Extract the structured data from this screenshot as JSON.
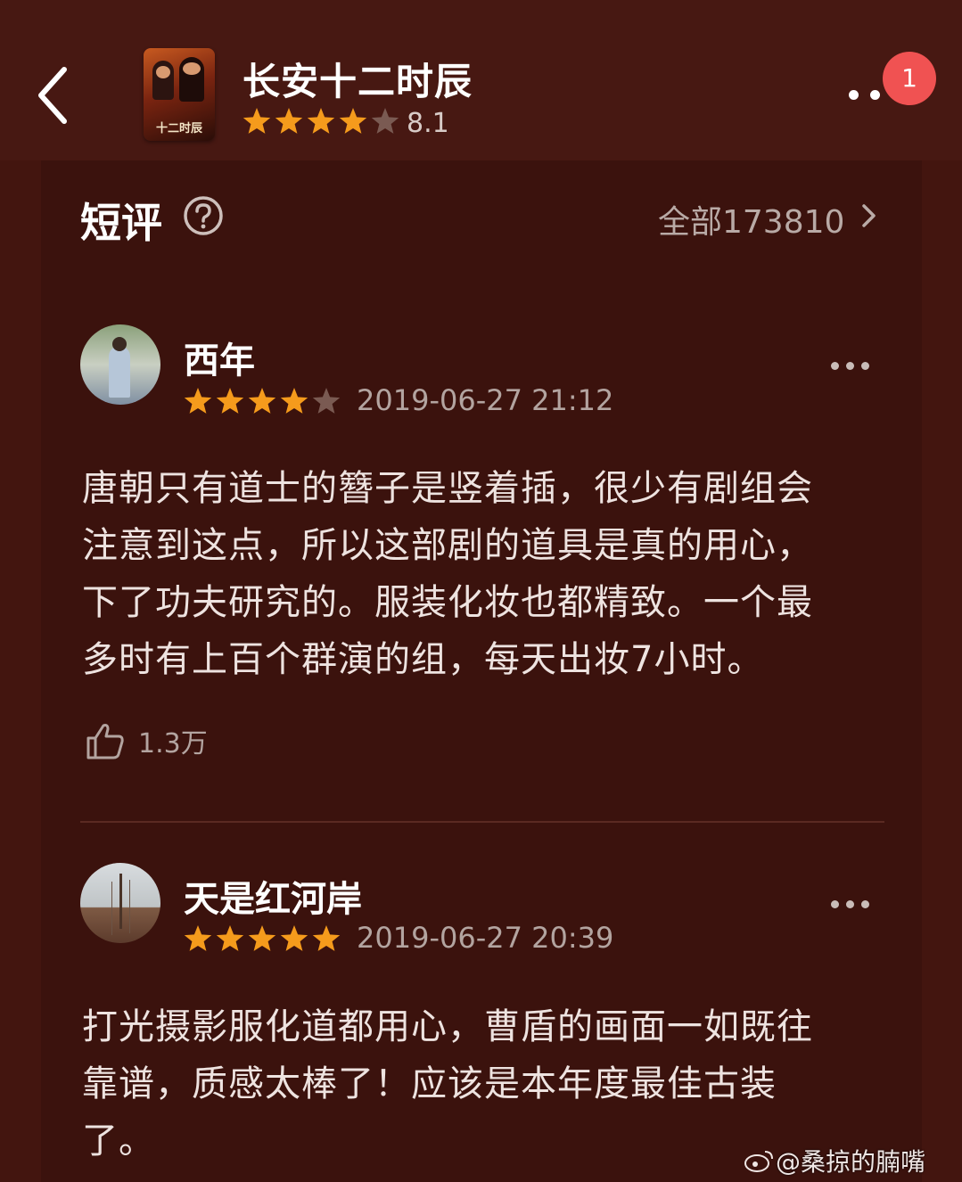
{
  "header": {
    "back_icon": "chevron-left-icon",
    "title": "长安十二时辰",
    "rating_stars": 4,
    "rating_score": "8.1",
    "poster_text": "十二时辰",
    "more_icon": "more-dots-icon",
    "badge_count": "1"
  },
  "section": {
    "title": "短评",
    "help_icon": "question-circle-icon",
    "all_label": "全部173810",
    "chevron_icon": "chevron-right-icon"
  },
  "reviews": [
    {
      "user": "西年",
      "stars": 4,
      "date": "2019-06-27 21:12",
      "text_lines": [
        "唐朝只有道士的簪子是竖着插，很少有剧组会",
        "注意到这点，所以这部剧的道具是真的用心，",
        "下了功夫研究的。服装化妆也都精致。一个最",
        "多时有上百个群演的组，每天出妆7小时。"
      ],
      "likes": "1.3万"
    },
    {
      "user": "天是红河岸",
      "stars": 5,
      "date": "2019-06-27 20:39",
      "text_lines": [
        "打光摄影服化道都用心，曹盾的画面一如既往",
        "靠谱，质感太棒了！应该是本年度最佳古装",
        "了。"
      ]
    }
  ],
  "watermark": {
    "text": "@桑掠的腩嘴",
    "icon": "weibo-icon"
  },
  "colors": {
    "background": "#43150f",
    "card": "#3b120d",
    "star_on": "#f59b1c",
    "star_off": "#7a5a52",
    "badge": "#f05252"
  }
}
